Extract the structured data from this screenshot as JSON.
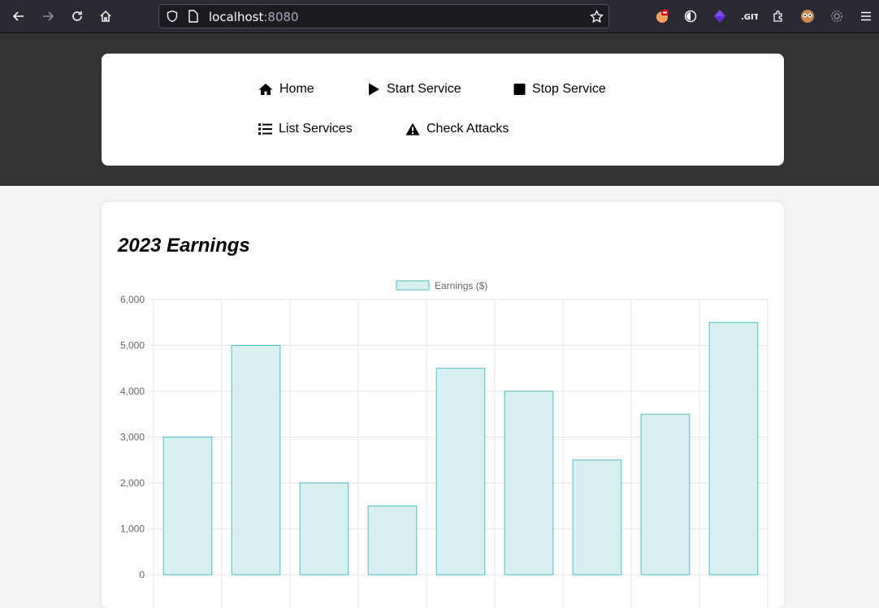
{
  "browser": {
    "url_host": "localhost",
    "url_port": ":8080"
  },
  "nav": {
    "items": [
      {
        "label": "Home",
        "icon": "home-icon"
      },
      {
        "label": "Start Service",
        "icon": "play-icon"
      },
      {
        "label": "Stop Service",
        "icon": "stop-icon"
      },
      {
        "label": "List Services",
        "icon": "list-icon"
      },
      {
        "label": "Check Attacks",
        "icon": "warning-icon"
      }
    ]
  },
  "card": {
    "title": "2023 Earnings"
  },
  "colors": {
    "bar_fill": "#d9f0f0",
    "bar_stroke": "#4bc0c0",
    "header_bg": "#333333"
  },
  "chart_data": {
    "type": "bar",
    "series": [
      {
        "name": "Earnings ($)",
        "values": [
          3000,
          5000,
          2000,
          1500,
          4500,
          4000,
          2500,
          3500,
          5500
        ]
      }
    ],
    "ylim": [
      0,
      6000
    ],
    "yticks": [
      "0",
      "1,000",
      "2,000",
      "3,000",
      "4,000",
      "5,000",
      "6,000"
    ],
    "grid": true,
    "legend": "top"
  }
}
